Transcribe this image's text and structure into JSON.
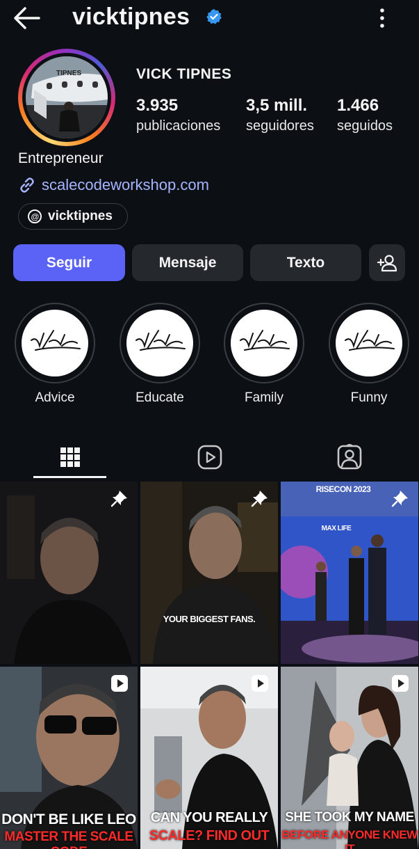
{
  "header": {
    "username": "vicktipnes",
    "back_icon": "arrow-left-icon",
    "verified_icon": "verified-badge-icon",
    "more_icon": "more-vertical-icon"
  },
  "profile": {
    "display_name": "VICK TIPNES",
    "bio": "Entrepreneur",
    "link": "scalecodeworkshop.com",
    "threads_handle": "vicktipnes",
    "avatar_text": "TIPNES",
    "stats": [
      {
        "value": "3.935",
        "label": "publicaciones"
      },
      {
        "value": "3,5 mill.",
        "label": "seguidores"
      },
      {
        "value": "1.466",
        "label": "seguidos"
      }
    ]
  },
  "actions": {
    "follow": "Seguir",
    "message": "Mensaje",
    "text": "Texto",
    "add_icon": "add-person-icon"
  },
  "highlights": [
    {
      "label": "Advice"
    },
    {
      "label": "Educate"
    },
    {
      "label": "Family"
    },
    {
      "label": "Funny"
    }
  ],
  "tabs": [
    "grid-icon",
    "reels-icon",
    "tagged-icon"
  ],
  "posts": [
    {
      "type": "pinned",
      "caption1": "",
      "caption2": ""
    },
    {
      "type": "pinned",
      "caption1": "YOUR BIGGEST FANS.",
      "caption2": ""
    },
    {
      "type": "pinned",
      "caption1": "MAX LIFE",
      "caption2": "RISECON 2023"
    },
    {
      "type": "reel",
      "caption1": "DON'T BE LIKE LEO",
      "caption2": "MASTER THE SCALE CODE"
    },
    {
      "type": "reel",
      "caption1": "CAN YOU REALLY",
      "caption2": "SCALE? FIND OUT"
    },
    {
      "type": "reel",
      "caption1": "SHE TOOK MY NAME",
      "caption2": "BEFORE ANYONE KNEW IT"
    }
  ],
  "colors": {
    "background": "#0c1014",
    "follow_button": "#5b63f6",
    "secondary_button": "#25292e",
    "link": "#a6b4ff",
    "verified": "#3897f0"
  }
}
